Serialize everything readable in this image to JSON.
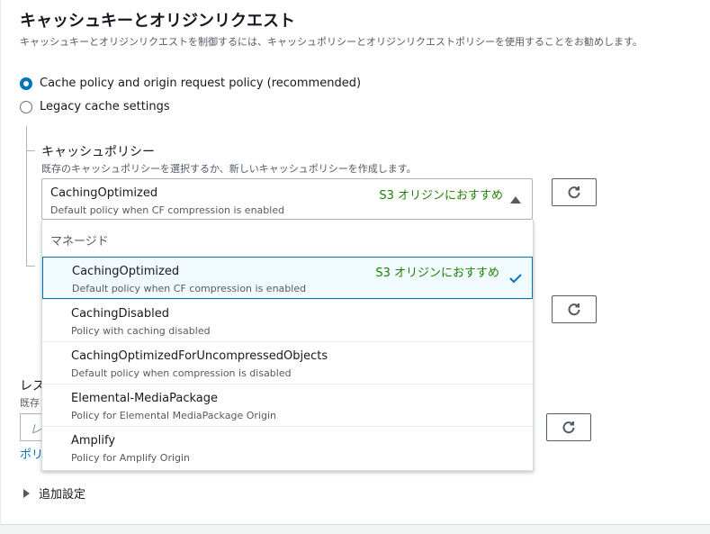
{
  "section": {
    "title": "キャッシュキーとオリジンリクエスト",
    "description": "キャッシュキーとオリジンリクエストを制御するには、キャッシュポリシーとオリジンリクエストポリシーを使用することをお勧めします。"
  },
  "radios": [
    {
      "label": "Cache policy and origin request policy (recommended)",
      "checked": true
    },
    {
      "label": "Legacy cache settings",
      "checked": false
    }
  ],
  "cache_policy": {
    "label": "キャッシュポリシー",
    "description": "既存のキャッシュポリシーを選択するか、新しいキャッシュポリシーを作成します。",
    "selected": {
      "name": "CachingOptimized",
      "description": "Default policy when CF compression is enabled",
      "tag": "S3 オリジンにおすすめ"
    },
    "group_label": "マネージド",
    "options": [
      {
        "name": "CachingOptimized",
        "description": "Default policy when CF compression is enabled",
        "tag": "S3 オリジンにおすすめ"
      },
      {
        "name": "CachingDisabled",
        "description": "Policy with caching disabled",
        "tag": ""
      },
      {
        "name": "CachingOptimizedForUncompressedObjects",
        "description": "Default policy when compression is disabled",
        "tag": ""
      },
      {
        "name": "Elemental-MediaPackage",
        "description": "Policy for Elemental MediaPackage Origin",
        "tag": ""
      },
      {
        "name": "Amplify",
        "description": "Policy for Amplify Origin",
        "tag": ""
      }
    ]
  },
  "obscured": {
    "label_fragment": "レス",
    "desc_fragment": "既存",
    "input_fragment": "レ",
    "link_fragment": "ポリ"
  },
  "advanced": {
    "label": "追加設定"
  },
  "colors": {
    "accent": "#0073bb",
    "recommend": "#1d8102"
  }
}
